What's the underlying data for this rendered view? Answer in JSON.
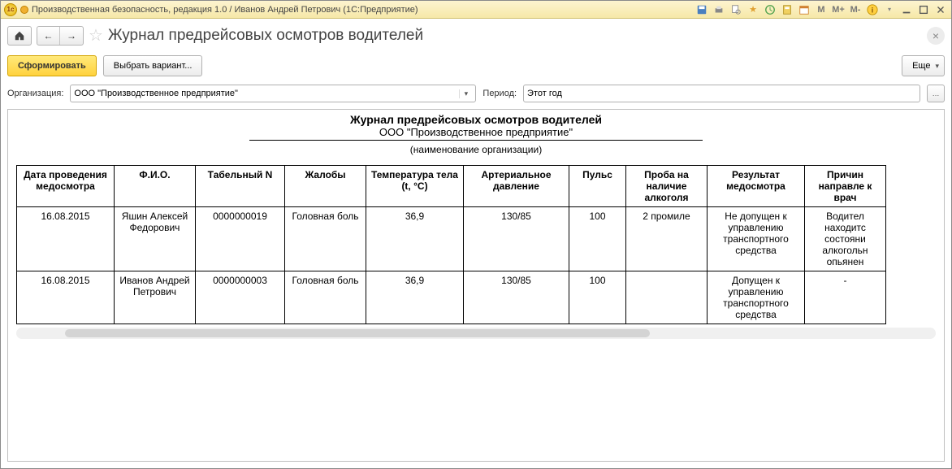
{
  "window": {
    "title": "Производственная безопасность, редакция 1.0 / Иванов Андрей Петрович  (1С:Предприятие)"
  },
  "header": {
    "page_title": "Журнал предрейсовых осмотров водителей"
  },
  "toolbar": {
    "form_btn": "Сформировать",
    "variant_btn": "Выбрать вариант...",
    "more_btn": "Еще"
  },
  "filters": {
    "org_label": "Организация:",
    "org_value": "ООО \"Производственное предприятие\"",
    "period_label": "Период:",
    "period_value": "Этот год"
  },
  "report": {
    "title": "Журнал предрейсовых осмотров водителей",
    "org": "ООО \"Производственное предприятие\"",
    "sub": "(наименование организации)",
    "columns": {
      "c1": "Дата проведения медосмотра",
      "c2": "Ф.И.О.",
      "c3": "Табельный N",
      "c4": "Жалобы",
      "c5": "Температура тела\n(t, °C)",
      "c6": "Артериальное давление",
      "c7": "Пульс",
      "c8": "Проба на наличие алкоголя",
      "c9": "Результат медосмотра",
      "c10": "Причин направле к врач"
    },
    "rows": [
      {
        "c1": "16.08.2015",
        "c2": "Яшин Алексей Федорович",
        "c3": "0000000019",
        "c4": "Головная боль",
        "c5": "36,9",
        "c6": "130/85",
        "c7": "100",
        "c8": "2 промиле",
        "c9": "Не допущен к управлению транспортного средства",
        "c10": "Водител находитс состояни алкогольн опьянен"
      },
      {
        "c1": "16.08.2015",
        "c2": "Иванов Андрей Петрович",
        "c3": "0000000003",
        "c4": "Головная боль",
        "c5": "36,9",
        "c6": "130/85",
        "c7": "100",
        "c8": "",
        "c9": "Допущен к управлению транспортного средства",
        "c10": "-"
      }
    ]
  }
}
